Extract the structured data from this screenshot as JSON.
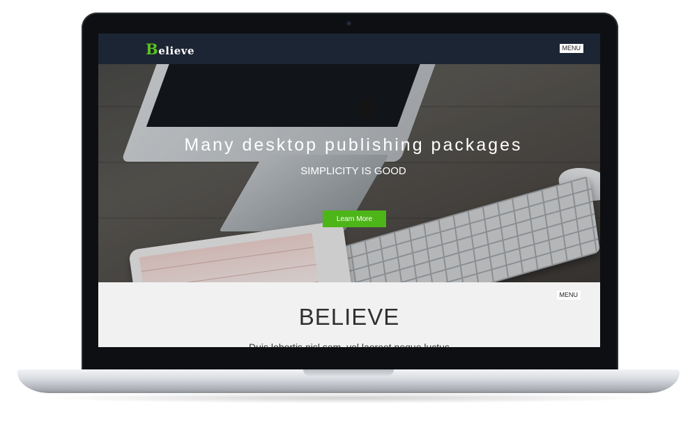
{
  "site": {
    "logo_initial": "B",
    "logo_rest": "elieve",
    "menu_label": "MENU"
  },
  "hero": {
    "title": "Many desktop publishing packages",
    "subtitle": "SIMPLICITY IS GOOD",
    "button_label": "Learn More"
  },
  "section": {
    "menu_label": "MENU",
    "title": "BELIEVE",
    "text": "Duis lobortis nisl sem, vel laoreet neque luctus"
  },
  "colors": {
    "navbar": "#1c2533",
    "accent": "#4eb519",
    "logo_accent": "#5bc21c"
  }
}
